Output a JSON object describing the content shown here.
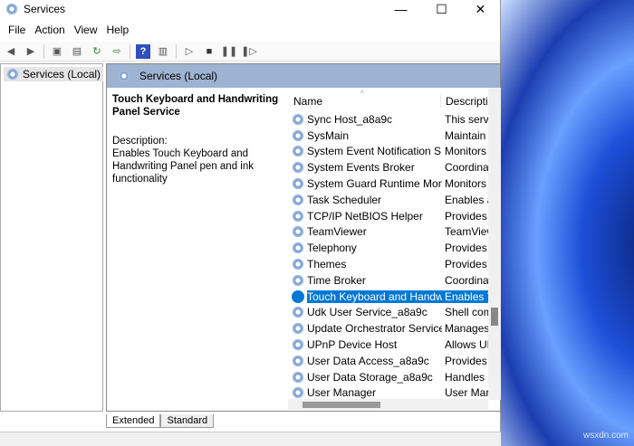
{
  "window": {
    "title": "Services",
    "min": "—",
    "max": "☐",
    "close": "✕"
  },
  "menu": [
    "File",
    "Action",
    "View",
    "Help"
  ],
  "tree": {
    "root": "Services (Local)"
  },
  "panel": {
    "header": "Services (Local)",
    "detail": {
      "title": "Touch Keyboard and Handwriting Panel Service",
      "desc_label": "Description:",
      "desc": "Enables Touch Keyboard and Handwriting Panel pen and ink functionality"
    },
    "columns": {
      "name": "Name",
      "desc": "Description"
    },
    "rows": [
      {
        "name": "Sync Host_a8a9c",
        "desc": "This servi"
      },
      {
        "name": "SysMain",
        "desc": "Maintain"
      },
      {
        "name": "System Event Notification S...",
        "desc": "Monitors"
      },
      {
        "name": "System Events Broker",
        "desc": "Coordina"
      },
      {
        "name": "System Guard Runtime Mon...",
        "desc": "Monitors"
      },
      {
        "name": "Task Scheduler",
        "desc": "Enables a"
      },
      {
        "name": "TCP/IP NetBIOS Helper",
        "desc": "Provides"
      },
      {
        "name": "TeamViewer",
        "desc": "TeamView"
      },
      {
        "name": "Telephony",
        "desc": "Provides"
      },
      {
        "name": "Themes",
        "desc": "Provides"
      },
      {
        "name": "Time Broker",
        "desc": "Coordina"
      },
      {
        "name": "Touch Keyboard and Handw...",
        "desc": "Enables T"
      },
      {
        "name": "Udk User Service_a8a9c",
        "desc": "Shell com"
      },
      {
        "name": "Update Orchestrator Service",
        "desc": "Manages"
      },
      {
        "name": "UPnP Device Host",
        "desc": "Allows UF"
      },
      {
        "name": "User Data Access_a8a9c",
        "desc": "Provides"
      },
      {
        "name": "User Data Storage_a8a9c",
        "desc": "Handles s"
      },
      {
        "name": "User Manager",
        "desc": "User Mar"
      }
    ]
  },
  "tabs": [
    "Extended",
    "Standard"
  ],
  "watermark": "wsxdn.com"
}
